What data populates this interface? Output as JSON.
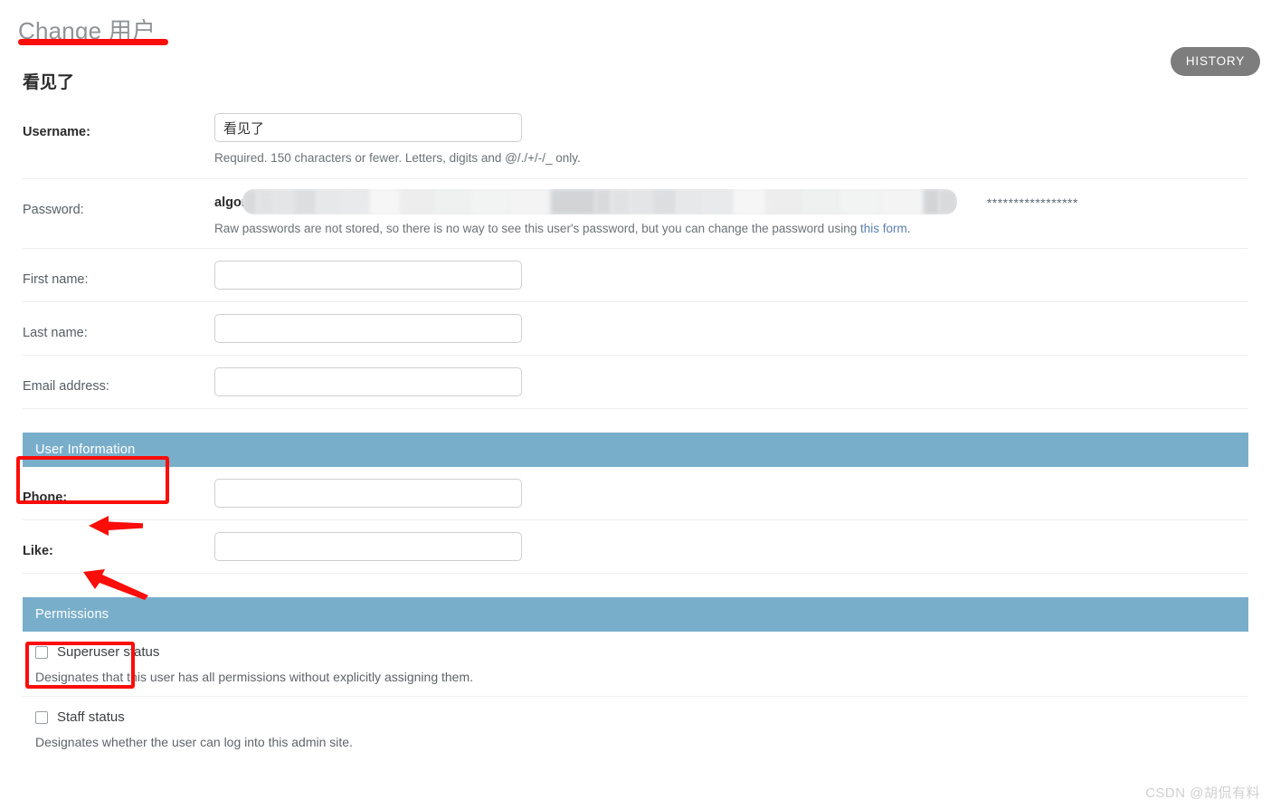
{
  "header": {
    "title": "Change 用户",
    "history_label": "HISTORY",
    "object_name": "看见了"
  },
  "form": {
    "rows": [
      {
        "label": "Username:",
        "value": "看见了",
        "help": "Required. 150 characters or fewer. Letters, digits and @/./+/-/_ only."
      },
      {
        "label": "Password:",
        "algorithm_text": "algorithr",
        "masked_value": "*****************",
        "help_before_link": "Raw passwords are not stored, so there is no way to see this user's password, but you can change the password using ",
        "help_link": "this form",
        "help_after_link": "."
      },
      {
        "label": "First name:",
        "value": ""
      },
      {
        "label": "Last name:",
        "value": ""
      },
      {
        "label": "Email address:",
        "value": ""
      }
    ]
  },
  "user_information": {
    "title": "User Information",
    "rows": [
      {
        "label": "Phone:",
        "value": ""
      },
      {
        "label": "Like:",
        "value": ""
      }
    ]
  },
  "permissions": {
    "title": "Permissions",
    "checkboxes": [
      {
        "label": "Superuser status",
        "checked": false,
        "help": "Designates that this user has all permissions without explicitly assigning them."
      },
      {
        "label": "Staff status",
        "checked": false,
        "help": "Designates whether the user can log into this admin site."
      }
    ]
  },
  "annotations": {
    "color": "#fb0d09",
    "title_underline": true,
    "boxes": [
      "user-information-header",
      "permissions-header"
    ],
    "arrows": [
      "phone-label-arrow",
      "like-label-arrow"
    ]
  },
  "watermark": {
    "text": "CSDN @胡侃有料"
  }
}
